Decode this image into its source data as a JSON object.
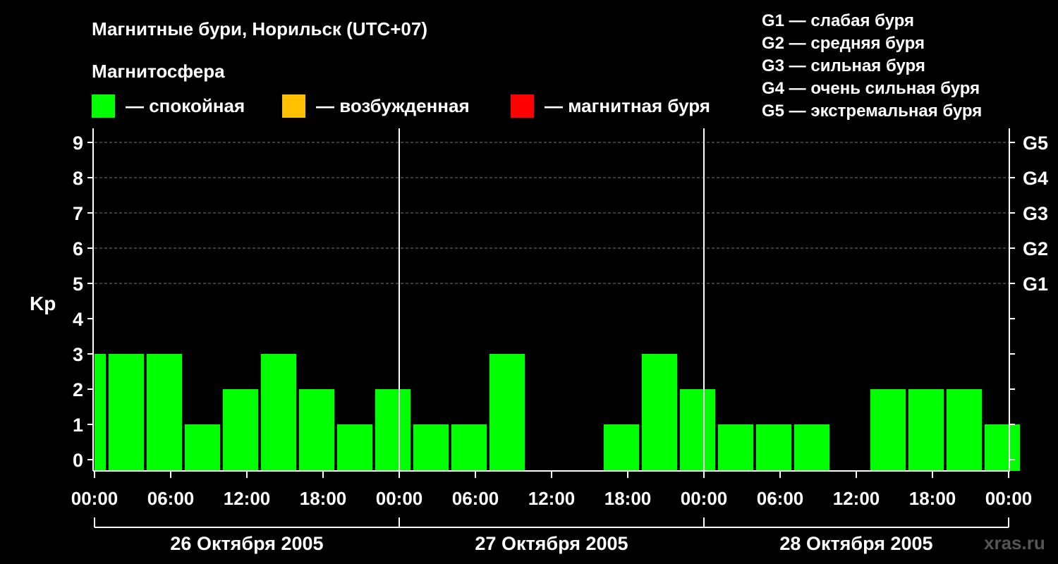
{
  "chart_data": {
    "type": "bar",
    "title": "Магнитные бури, Норильск (UTC+07)",
    "legend_title": "Магнитосфера",
    "legend": [
      {
        "label": "— спокойная",
        "color": "#00ff00"
      },
      {
        "label": "— возбужденная",
        "color": "#ffc000"
      },
      {
        "label": "— магнитная буря",
        "color": "#ff0000"
      }
    ],
    "g_scale_legend": [
      "G1 — слабая буря",
      "G2 — средняя буря",
      "G3 — сильная буря",
      "G4 — очень сильная буря",
      "G5 — экстремальная буря"
    ],
    "ylabel": "Kp",
    "ylim": [
      0,
      9
    ],
    "y_ticks": [
      "0",
      "1",
      "2",
      "3",
      "4",
      "5",
      "6",
      "7",
      "8",
      "9"
    ],
    "right_axis_labels": [
      {
        "kp": 5,
        "label": "G1"
      },
      {
        "kp": 6,
        "label": "G2"
      },
      {
        "kp": 7,
        "label": "G3"
      },
      {
        "kp": 8,
        "label": "G4"
      },
      {
        "kp": 9,
        "label": "G5"
      }
    ],
    "x_hours_range": [
      0,
      72
    ],
    "x_tick_labels": [
      "00:00",
      "06:00",
      "12:00",
      "18:00",
      "00:00",
      "06:00",
      "12:00",
      "18:00",
      "00:00",
      "06:00",
      "12:00",
      "18:00",
      "00:00"
    ],
    "days": [
      "26 Октября 2005",
      "27 Октября 2005",
      "28 Октября 2005"
    ],
    "grid_dashed_at_kp": [
      5,
      6,
      7,
      8,
      9
    ],
    "series": [
      {
        "values": [
          {
            "start": "00:00",
            "kp": 3,
            "level": "спокойная",
            "partial": true
          },
          {
            "start": "01:00",
            "kp": 3,
            "level": "спокойная"
          },
          {
            "start": "04:00",
            "kp": 3,
            "level": "спокойная"
          },
          {
            "start": "07:00",
            "kp": 1,
            "level": "спокойная"
          },
          {
            "start": "10:00",
            "kp": 2,
            "level": "спокойная"
          },
          {
            "start": "13:00",
            "kp": 3,
            "level": "спокойная"
          },
          {
            "start": "16:00",
            "kp": 2,
            "level": "спокойная"
          },
          {
            "start": "19:00",
            "kp": 1,
            "level": "спокойная"
          },
          {
            "start": "22:00",
            "kp": 2,
            "level": "спокойная"
          },
          {
            "start": "01:00",
            "kp": 1,
            "level": "спокойная"
          },
          {
            "start": "04:00",
            "kp": 1,
            "level": "спокойная"
          },
          {
            "start": "07:00",
            "kp": 3,
            "level": "спокойная"
          },
          {
            "start": "10:00",
            "kp": 0,
            "level": "спокойная"
          },
          {
            "start": "13:00",
            "kp": 0,
            "level": "спокойная"
          },
          {
            "start": "16:00",
            "kp": 1,
            "level": "спокойная"
          },
          {
            "start": "19:00",
            "kp": 3,
            "level": "спокойная"
          },
          {
            "start": "22:00",
            "kp": 2,
            "level": "спокойная"
          },
          {
            "start": "01:00",
            "kp": 1,
            "level": "спокойная"
          },
          {
            "start": "04:00",
            "kp": 1,
            "level": "спокойная"
          },
          {
            "start": "07:00",
            "kp": 1,
            "level": "спокойная"
          },
          {
            "start": "10:00",
            "kp": 0,
            "level": "спокойная"
          },
          {
            "start": "13:00",
            "kp": 2,
            "level": "спокойная"
          },
          {
            "start": "16:00",
            "kp": 2,
            "level": "спокойная"
          },
          {
            "start": "19:00",
            "kp": 2,
            "level": "спокойная"
          },
          {
            "start": "22:00",
            "kp": 1,
            "level": "спокойная"
          }
        ]
      }
    ],
    "watermark": "xras.ru"
  }
}
